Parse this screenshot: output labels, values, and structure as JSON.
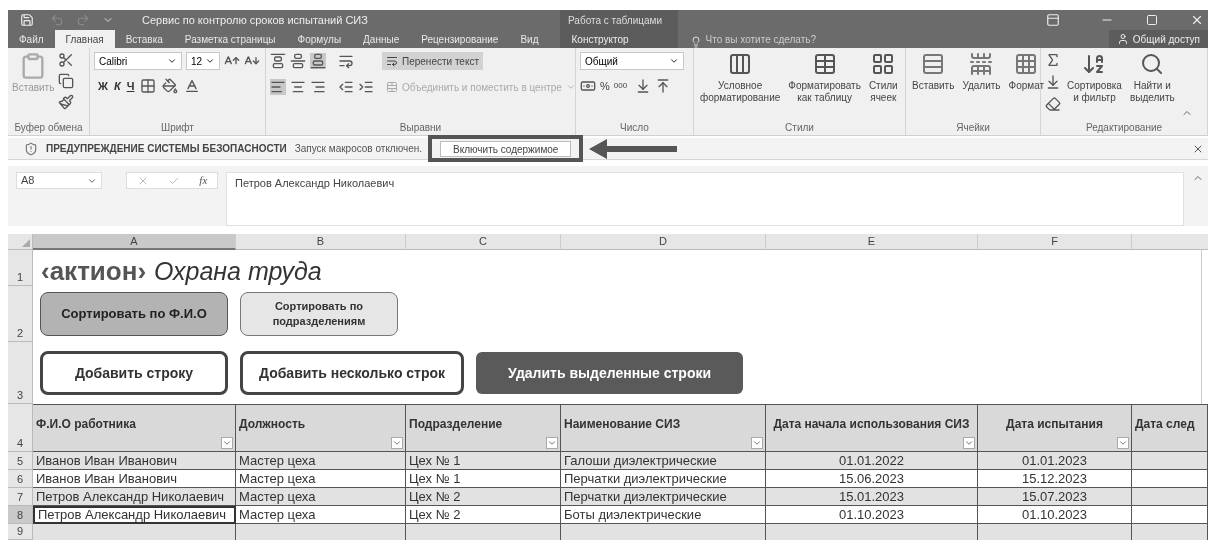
{
  "window": {
    "title": "Сервис по контролю сроков испытаний СИЗ",
    "context_group": "Работа с таблицами"
  },
  "menu_tabs": [
    {
      "label": "Файл",
      "selected": false
    },
    {
      "label": "Главная",
      "selected": true
    },
    {
      "label": "Вставка",
      "selected": false
    },
    {
      "label": "Разметка страницы",
      "selected": false
    },
    {
      "label": "Формулы",
      "selected": false
    },
    {
      "label": "Данные",
      "selected": false
    },
    {
      "label": "Рецензирование",
      "selected": false
    },
    {
      "label": "Вид",
      "selected": false
    },
    {
      "label": "Конструктор",
      "selected": false,
      "kind": "context"
    }
  ],
  "tell_me": {
    "placeholder": "Что вы хотите сделать?"
  },
  "share_button": "Общий доступ",
  "ribbon": {
    "clipboard": {
      "paste": "Вставить",
      "label": "Буфер обмена"
    },
    "font": {
      "name": "Calibri",
      "size": "12",
      "bold": "Ж",
      "italic": "К",
      "underline": "Ч",
      "label": "Шрифт"
    },
    "alignment": {
      "wrap": "Перенести текст",
      "merge": "Объединить и поместить в центре",
      "label": "Выравни"
    },
    "number": {
      "format": "Общий",
      "percent": "%",
      "thousands": "000",
      "label": "Число"
    },
    "styles": {
      "buttons": [
        {
          "lines": [
            "Условное",
            "форматирование"
          ]
        },
        {
          "lines": [
            "Форматировать",
            "как таблицу"
          ]
        },
        {
          "lines": [
            "Стили",
            "ячеек"
          ]
        }
      ],
      "label": "Стили"
    },
    "cells": {
      "buttons": [
        "Вставить",
        "Удалить",
        "Формат"
      ],
      "label": "Ячейки"
    },
    "editing": {
      "buttons": [
        {
          "lines": [
            "Сортировка",
            "и фильтр"
          ]
        },
        {
          "lines": [
            "Найти и",
            "выделить"
          ]
        }
      ],
      "label": "Редактирование"
    }
  },
  "security_bar": {
    "title": "ПРЕДУПРЕЖДЕНИЕ СИСТЕМЫ БЕЗОПАСНОСТИ",
    "message": "Запуск макросов отключен.",
    "button": "Включить содержимое"
  },
  "formula_bar": {
    "name_box": "A8",
    "function_label": "fx",
    "value": "Петров Александр Николаевич"
  },
  "column_headers": [
    {
      "label": "A",
      "selected": true
    },
    {
      "label": "B",
      "selected": false
    },
    {
      "label": "C",
      "selected": false
    },
    {
      "label": "D",
      "selected": false
    },
    {
      "label": "E",
      "selected": false
    },
    {
      "label": "F",
      "selected": false
    }
  ],
  "row_headers": [
    {
      "label": "1",
      "selected": false
    },
    {
      "label": "2",
      "selected": false
    },
    {
      "label": "3",
      "selected": false
    },
    {
      "label": "4",
      "selected": false
    },
    {
      "label": "5",
      "selected": false
    },
    {
      "label": "6",
      "selected": false
    },
    {
      "label": "7",
      "selected": false
    },
    {
      "label": "8",
      "selected": true
    },
    {
      "label": "9",
      "selected": false
    }
  ],
  "logo": {
    "brand": "‹актион›",
    "product": "Охрана труда"
  },
  "sheet_buttons": [
    [
      {
        "label": "Сортировать по Ф.И.О",
        "kind": "filled"
      },
      {
        "label": "Сортировать по подразделениям",
        "kind": "light"
      }
    ],
    [
      {
        "label": "Добавить строку",
        "kind": "outline"
      },
      {
        "label": "Добавить несколько строк",
        "kind": "outline"
      },
      {
        "label": "Удалить выделенные строки",
        "kind": "dark"
      }
    ]
  ],
  "table": {
    "columns": [
      {
        "label": "Ф.И.О работника",
        "kind": "text",
        "filter": true
      },
      {
        "label": "Должность",
        "kind": "text",
        "filter": true
      },
      {
        "label": "Подразделение",
        "kind": "text",
        "filter": true
      },
      {
        "label": "Наименование СИЗ",
        "kind": "text",
        "filter": true
      },
      {
        "label": "Дата начала использования СИЗ",
        "kind": "date",
        "filter": true
      },
      {
        "label": "Дата испытания",
        "kind": "date",
        "filter": true
      },
      {
        "label": "Дата след",
        "kind": "text",
        "filter": false
      }
    ],
    "rows": [
      {
        "cells": [
          "Иванов Иван Иванович",
          "Мастер цеха",
          "Цех № 1",
          "Галоши диэлектрические",
          "01.01.2022",
          "01.01.2023"
        ],
        "selected": false
      },
      {
        "cells": [
          "Иванов Иван Иванович",
          "Мастер цеха",
          "Цех № 1",
          "Перчатки диэлектрические",
          "15.06.2023",
          "15.12.2023"
        ],
        "selected": false
      },
      {
        "cells": [
          "Петров Александр Николаевич",
          "Мастер цеха",
          "Цех № 2",
          "Перчатки диэлектрические",
          "15.01.2023",
          "15.07.2023"
        ],
        "selected": false
      },
      {
        "cells": [
          "Петров Александр Николаевич",
          "Мастер цеха",
          "Цех № 2",
          "Боты диэлектрические",
          "01.10.2023",
          "01.10.2023"
        ],
        "selected": true
      }
    ]
  }
}
